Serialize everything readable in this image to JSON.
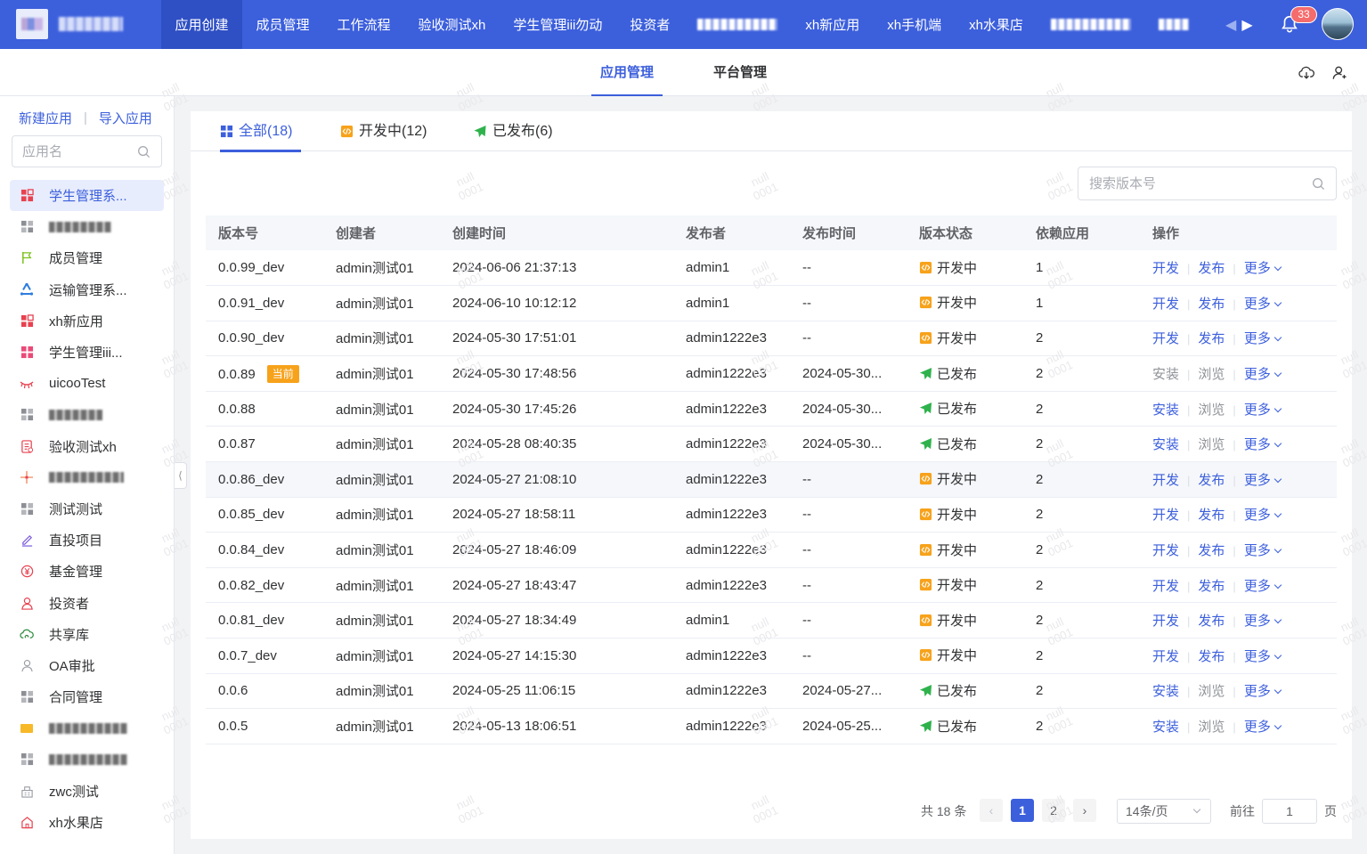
{
  "topnav": {
    "items": [
      {
        "label": "应用创建",
        "active": true
      },
      {
        "label": "成员管理"
      },
      {
        "label": "工作流程"
      },
      {
        "label": "验收测试xh"
      },
      {
        "label": "学生管理iii勿动"
      },
      {
        "label": "投资者"
      },
      {
        "label": "",
        "blurred": true
      },
      {
        "label": "xh新应用"
      },
      {
        "label": "xh手机端"
      },
      {
        "label": "xh水果店"
      },
      {
        "label": "",
        "blurred": true
      },
      {
        "label": "",
        "blurred": true
      }
    ],
    "notification_count": "33"
  },
  "subnav": {
    "tabs": [
      {
        "label": "应用管理",
        "active": true
      },
      {
        "label": "平台管理"
      }
    ]
  },
  "sidebar": {
    "new_app": "新建应用",
    "import_app": "导入应用",
    "search_placeholder": "应用名",
    "apps": [
      {
        "label": "学生管理系...",
        "icon": "grid-red-icon",
        "active": true
      },
      {
        "label": "",
        "icon": "grid-gray-icon",
        "blurred": true
      },
      {
        "label": "成员管理",
        "icon": "flag-icon"
      },
      {
        "label": "运输管理系...",
        "icon": "recycle-icon"
      },
      {
        "label": "xh新应用",
        "icon": "grid-red-icon"
      },
      {
        "label": "学生管理iii...",
        "icon": "grid-pink-icon"
      },
      {
        "label": "uicooTest",
        "icon": "eyelash-icon"
      },
      {
        "label": "",
        "icon": "grid-gray-icon",
        "blurred": true
      },
      {
        "label": "验收测试xh",
        "icon": "document-icon"
      },
      {
        "label": "",
        "icon": "sparkle-icon",
        "blurred": true
      },
      {
        "label": "测试测试",
        "icon": "grid-gray-icon"
      },
      {
        "label": "直投项目",
        "icon": "pen-icon"
      },
      {
        "label": "基金管理",
        "icon": "yen-icon"
      },
      {
        "label": "投资者",
        "icon": "person-icon"
      },
      {
        "label": "共享库",
        "icon": "cloud-sync-icon"
      },
      {
        "label": "OA审批",
        "icon": "user-outline-icon"
      },
      {
        "label": "合同管理",
        "icon": "grid-gray-icon"
      },
      {
        "label": "",
        "icon": "folder-icon",
        "blurred": true
      },
      {
        "label": "",
        "icon": "grid-gray-icon",
        "blurred": true
      },
      {
        "label": "zwc测试",
        "icon": "building-icon"
      },
      {
        "label": "xh水果店",
        "icon": "home-icon"
      }
    ]
  },
  "filter_tabs": [
    {
      "label": "全部(18)",
      "icon": "grid-icon",
      "active": true
    },
    {
      "label": "开发中(12)",
      "icon": "code-icon"
    },
    {
      "label": "已发布(6)",
      "icon": "paper-plane-icon"
    }
  ],
  "version_search_placeholder": "搜索版本号",
  "table": {
    "columns": [
      "版本号",
      "创建者",
      "创建时间",
      "发布者",
      "发布时间",
      "版本状态",
      "依赖应用",
      "操作"
    ],
    "current_tag": "当前",
    "more_label": "更多",
    "rows": [
      {
        "version": "0.0.99_dev",
        "creator": "admin测试01",
        "created": "2024-06-06 21:37:13",
        "publisher": "admin1",
        "published": "--",
        "status": "开发中",
        "status_type": "dev",
        "deps": "1",
        "op1": "开发",
        "op2": "发布"
      },
      {
        "version": "0.0.91_dev",
        "creator": "admin测试01",
        "created": "2024-06-10 10:12:12",
        "publisher": "admin1",
        "published": "--",
        "status": "开发中",
        "status_type": "dev",
        "deps": "1",
        "op1": "开发",
        "op2": "发布"
      },
      {
        "version": "0.0.90_dev",
        "creator": "admin测试01",
        "created": "2024-05-30 17:51:01",
        "publisher": "admin1222e3",
        "published": "--",
        "status": "开发中",
        "status_type": "dev",
        "deps": "2",
        "op1": "开发",
        "op2": "发布"
      },
      {
        "version": "0.0.89",
        "current": true,
        "creator": "admin测试01",
        "created": "2024-05-30 17:48:56",
        "publisher": "admin1222e3",
        "published": "2024-05-30...",
        "status": "已发布",
        "status_type": "pub",
        "deps": "2",
        "op1": "安装",
        "op2": "浏览",
        "op1_disabled": true
      },
      {
        "version": "0.0.88",
        "creator": "admin测试01",
        "created": "2024-05-30 17:45:26",
        "publisher": "admin1222e3",
        "published": "2024-05-30...",
        "status": "已发布",
        "status_type": "pub",
        "deps": "2",
        "op1": "安装",
        "op2": "浏览"
      },
      {
        "version": "0.0.87",
        "creator": "admin测试01",
        "created": "2024-05-28 08:40:35",
        "publisher": "admin1222e3",
        "published": "2024-05-30...",
        "status": "已发布",
        "status_type": "pub",
        "deps": "2",
        "op1": "安装",
        "op2": "浏览"
      },
      {
        "version": "0.0.86_dev",
        "creator": "admin测试01",
        "created": "2024-05-27 21:08:10",
        "publisher": "admin1222e3",
        "published": "--",
        "status": "开发中",
        "status_type": "dev",
        "deps": "2",
        "op1": "开发",
        "op2": "发布",
        "hover": true
      },
      {
        "version": "0.0.85_dev",
        "creator": "admin测试01",
        "created": "2024-05-27 18:58:11",
        "publisher": "admin1222e3",
        "published": "--",
        "status": "开发中",
        "status_type": "dev",
        "deps": "2",
        "op1": "开发",
        "op2": "发布"
      },
      {
        "version": "0.0.84_dev",
        "creator": "admin测试01",
        "created": "2024-05-27 18:46:09",
        "publisher": "admin1222e3",
        "published": "--",
        "status": "开发中",
        "status_type": "dev",
        "deps": "2",
        "op1": "开发",
        "op2": "发布"
      },
      {
        "version": "0.0.82_dev",
        "creator": "admin测试01",
        "created": "2024-05-27 18:43:47",
        "publisher": "admin1222e3",
        "published": "--",
        "status": "开发中",
        "status_type": "dev",
        "deps": "2",
        "op1": "开发",
        "op2": "发布"
      },
      {
        "version": "0.0.81_dev",
        "creator": "admin测试01",
        "created": "2024-05-27 18:34:49",
        "publisher": "admin1",
        "published": "--",
        "status": "开发中",
        "status_type": "dev",
        "deps": "2",
        "op1": "开发",
        "op2": "发布"
      },
      {
        "version": "0.0.7_dev",
        "creator": "admin测试01",
        "created": "2024-05-27 14:15:30",
        "publisher": "admin1222e3",
        "published": "--",
        "status": "开发中",
        "status_type": "dev",
        "deps": "2",
        "op1": "开发",
        "op2": "发布"
      },
      {
        "version": "0.0.6",
        "creator": "admin测试01",
        "created": "2024-05-25 11:06:15",
        "publisher": "admin1222e3",
        "published": "2024-05-27...",
        "status": "已发布",
        "status_type": "pub",
        "deps": "2",
        "op1": "安装",
        "op2": "浏览"
      },
      {
        "version": "0.0.5",
        "creator": "admin测试01",
        "created": "2024-05-13 18:06:51",
        "publisher": "admin1222e3",
        "published": "2024-05-25...",
        "status": "已发布",
        "status_type": "pub",
        "deps": "2",
        "op1": "安装",
        "op2": "浏览"
      }
    ]
  },
  "pagination": {
    "total": "共 18 条",
    "pages": [
      "1",
      "2"
    ],
    "current_page": "1",
    "page_size": "14条/页",
    "goto_label": "前往",
    "goto_value": "1",
    "page_suffix": "页"
  },
  "watermark": [
    "null",
    "0001"
  ],
  "colors": {
    "primary": "#3c5fdc",
    "dev": "#f7a21b",
    "published": "#2fb24c",
    "badge": "#f56c6c"
  }
}
